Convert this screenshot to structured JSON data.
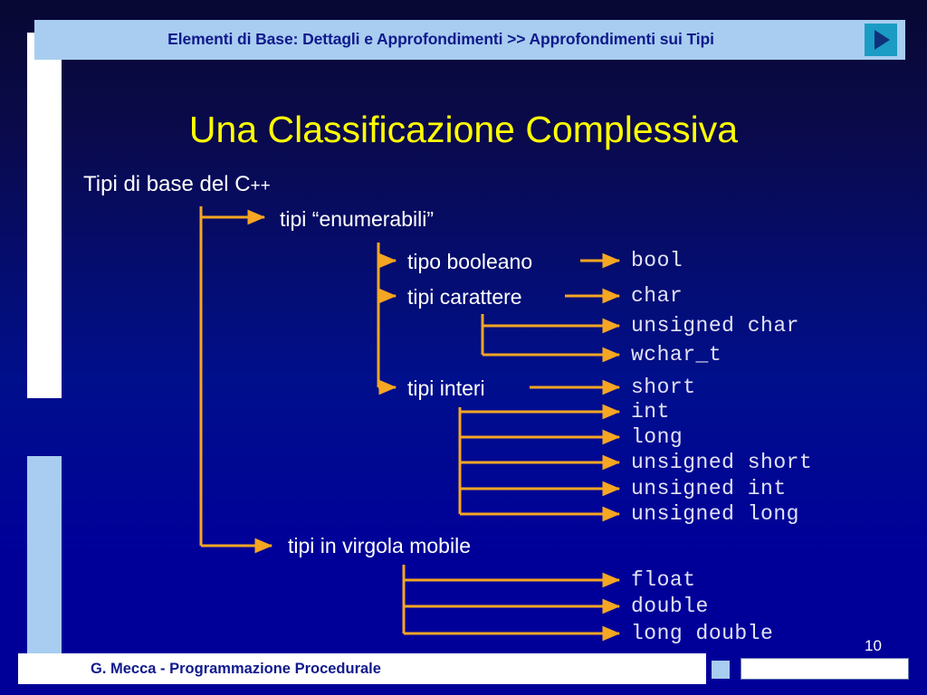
{
  "header": {
    "title": "Elementi di Base: Dettagli e Approfondimenti >> Approfondimenti sui Tipi",
    "next_icon": "play-triangle-icon"
  },
  "slide": {
    "title": "Una Classificazione Complessiva",
    "subtitle_main": "Tipi di base del C",
    "subtitle_suffix": "++"
  },
  "diagram": {
    "root_label": "Tipi di base del C++",
    "categories": [
      {
        "label": "tipi “enumerabili”",
        "children": [
          {
            "label": "tipo booleano",
            "types": [
              "bool"
            ]
          },
          {
            "label": "tipi carattere",
            "types": [
              "char",
              "unsigned char",
              "wchar_t"
            ]
          },
          {
            "label": "tipi interi",
            "types": [
              "short",
              "int",
              "long",
              "unsigned short",
              "unsigned int",
              "unsigned long"
            ]
          }
        ]
      },
      {
        "label": "tipi in virgola mobile",
        "children": [
          {
            "label": "",
            "types": [
              "float",
              "double",
              "long double"
            ]
          }
        ]
      }
    ],
    "labels": {
      "enumerabili": "tipi “enumerabili”",
      "booleano": "tipo booleano",
      "carattere": "tipi carattere",
      "interi": "tipi interi",
      "virgola_mobile": "tipi in virgola mobile"
    },
    "types": {
      "bool": "bool",
      "char": "char",
      "unsigned_char": "unsigned char",
      "wchar_t": "wchar_t",
      "short": "short",
      "int": "int",
      "long": "long",
      "unsigned_short": "unsigned short",
      "unsigned_int": "unsigned int",
      "unsigned_long": "unsigned long",
      "float": "float",
      "double": "double",
      "long_double": "long double"
    },
    "arrow_color": "#f5a623",
    "label_color": "#ffffff",
    "type_color": "#e2e2f5"
  },
  "footer": {
    "credit": "G. Mecca - Programmazione Procedurale",
    "page_number": "10"
  },
  "colors": {
    "background_top": "#080833",
    "background_bottom": "#000099",
    "header_bar": "#a8cdf0",
    "header_text": "#101a8c",
    "title_yellow": "#ffff00",
    "accent_orange": "#f5a623",
    "next_button": "#1a9cc4"
  }
}
